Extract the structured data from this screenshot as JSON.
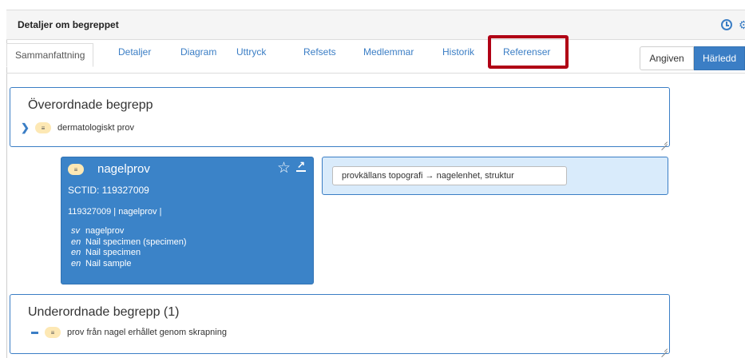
{
  "header": {
    "title": "Detaljer om begreppet"
  },
  "tabs": [
    {
      "label": "Sammanfattning",
      "active": true
    },
    {
      "label": "Detaljer"
    },
    {
      "label": "Diagram"
    },
    {
      "label": "Uttryck"
    },
    {
      "label": "Refsets"
    },
    {
      "label": "Medlemmar"
    },
    {
      "label": "Historik"
    },
    {
      "label": "Referenser",
      "highlighted": true
    }
  ],
  "view_toggle": {
    "stated_label": "Angiven",
    "inferred_label": "Härledd",
    "selected": "Härledd"
  },
  "parents": {
    "title": "Överordnade begrepp",
    "items": [
      {
        "label": "dermatologiskt prov",
        "icon": "chevron-right-icon"
      }
    ]
  },
  "concept": {
    "name": "nagelprov",
    "sctid_line": "SCTID: 119327009",
    "fsn_line": "119327009 | nagelprov |",
    "descriptions": [
      {
        "lang": "sv",
        "term": "nagelprov"
      },
      {
        "lang": "en",
        "term": "Nail specimen (specimen)"
      },
      {
        "lang": "en",
        "term": "Nail specimen"
      },
      {
        "lang": "en",
        "term": "Nail sample"
      }
    ]
  },
  "attributes": {
    "items": [
      {
        "label": "provkällans topografi → nagelenhet, struktur"
      }
    ]
  },
  "children": {
    "title": "Underordnade begrepp (1)",
    "items": [
      {
        "label": "prov från nagel erhållet genom skrapning",
        "icon": "dash-icon"
      }
    ]
  },
  "colors": {
    "accent": "#3b7ec5",
    "card": "#3b83c8",
    "highlight": "#b00015",
    "pill": "#fde8b4",
    "attr_bg": "#d9ebfb"
  }
}
